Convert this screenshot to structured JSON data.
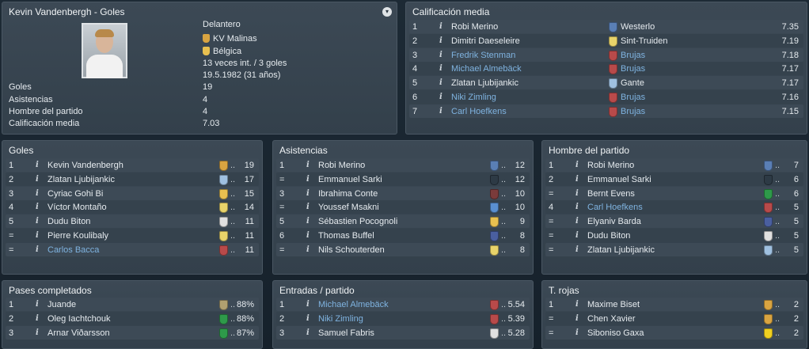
{
  "profile": {
    "title": "Kevin Vandenbergh - Goles",
    "position": "Delantero",
    "club": "KV Malinas",
    "nation": "Bélgica",
    "caps": "13 veces int. / 3 goles",
    "dob": "19.5.1982 (31 años)",
    "stats": [
      {
        "label": "Goles",
        "value": "19"
      },
      {
        "label": "Asistencias",
        "value": "4"
      },
      {
        "label": "Hombre del partido",
        "value": "4"
      },
      {
        "label": "Calificación media",
        "value": "7.03"
      }
    ]
  },
  "calificacion": {
    "title": "Calificación media",
    "rows": [
      {
        "rank": "1",
        "name": "Robi Merino",
        "club": "Westerlo",
        "value": "7.35",
        "link": false,
        "badge": "#5a7fb5"
      },
      {
        "rank": "2",
        "name": "Dimitri Daeseleire",
        "club": "Sint-Truiden",
        "value": "7.19",
        "link": false,
        "badge": "#e8d36a"
      },
      {
        "rank": "3",
        "name": "Fredrik Stenman",
        "club": "Brujas",
        "value": "7.18",
        "link": true,
        "badge": "#b84a4a"
      },
      {
        "rank": "4",
        "name": "Michael Almebäck",
        "club": "Brujas",
        "value": "7.17",
        "link": true,
        "badge": "#b84a4a"
      },
      {
        "rank": "5",
        "name": "Zlatan Ljubijankic",
        "club": "Gante",
        "value": "7.17",
        "link": false,
        "badge": "#9fc0e0"
      },
      {
        "rank": "6",
        "name": "Niki Zimling",
        "club": "Brujas",
        "value": "7.16",
        "link": true,
        "badge": "#b84a4a"
      },
      {
        "rank": "7",
        "name": "Carl Hoefkens",
        "club": "Brujas",
        "value": "7.15",
        "link": true,
        "badge": "#b84a4a"
      }
    ]
  },
  "goles": {
    "title": "Goles",
    "rows": [
      {
        "rank": "1",
        "name": "Kevin Vandenbergh",
        "value": "19",
        "link": false,
        "badge": "#d9a441"
      },
      {
        "rank": "2",
        "name": "Zlatan Ljubijankic",
        "value": "17",
        "link": false,
        "badge": "#9fc0e0"
      },
      {
        "rank": "3",
        "name": "Cyriac Gohi Bi",
        "value": "15",
        "link": false,
        "badge": "#e8c050"
      },
      {
        "rank": "4",
        "name": "Víctor Montaño",
        "value": "14",
        "link": false,
        "badge": "#e8d36a"
      },
      {
        "rank": "5",
        "name": "Dudu Biton",
        "value": "11",
        "link": false,
        "badge": "#e0e0e0"
      },
      {
        "rank": "=",
        "name": "Pierre Koulibaly",
        "value": "11",
        "link": false,
        "badge": "#e8d36a"
      },
      {
        "rank": "=",
        "name": "Carlos Bacca",
        "value": "11",
        "link": true,
        "badge": "#b84a4a"
      }
    ]
  },
  "asistencias": {
    "title": "Asistencias",
    "rows": [
      {
        "rank": "1",
        "name": "Robi Merino",
        "value": "12",
        "link": false,
        "badge": "#5a7fb5"
      },
      {
        "rank": "=",
        "name": "Emmanuel Sarki",
        "value": "12",
        "link": false,
        "badge": "#2d3a45"
      },
      {
        "rank": "3",
        "name": "Ibrahima Conte",
        "value": "10",
        "link": false,
        "badge": "#7a3b3b"
      },
      {
        "rank": "=",
        "name": "Youssef Msakni",
        "value": "10",
        "link": false,
        "badge": "#5a8fd0"
      },
      {
        "rank": "5",
        "name": "Sébastien Pocognoli",
        "value": "9",
        "link": false,
        "badge": "#e8c050"
      },
      {
        "rank": "6",
        "name": "Thomas Buffel",
        "value": "8",
        "link": false,
        "badge": "#4a5fa0"
      },
      {
        "rank": "=",
        "name": "Nils Schouterden",
        "value": "8",
        "link": false,
        "badge": "#e8d36a"
      }
    ]
  },
  "hombre": {
    "title": "Hombre del partido",
    "rows": [
      {
        "rank": "1",
        "name": "Robi Merino",
        "value": "7",
        "link": false,
        "badge": "#5a7fb5"
      },
      {
        "rank": "2",
        "name": "Emmanuel Sarki",
        "value": "6",
        "link": false,
        "badge": "#2d3a45"
      },
      {
        "rank": "=",
        "name": "Bernt Evens",
        "value": "6",
        "link": false,
        "badge": "#2e9a4a"
      },
      {
        "rank": "4",
        "name": "Carl Hoefkens",
        "value": "5",
        "link": true,
        "badge": "#b84a4a"
      },
      {
        "rank": "=",
        "name": "Elyaniv Barda",
        "value": "5",
        "link": false,
        "badge": "#4a5fa0"
      },
      {
        "rank": "=",
        "name": "Dudu Biton",
        "value": "5",
        "link": false,
        "badge": "#e0e0e0"
      },
      {
        "rank": "=",
        "name": "Zlatan Ljubijankic",
        "value": "5",
        "link": false,
        "badge": "#9fc0e0"
      }
    ]
  },
  "pases": {
    "title": "Pases completados",
    "rows": [
      {
        "rank": "1",
        "name": "Juande",
        "value": "88%",
        "link": false,
        "badge": "#b0a070"
      },
      {
        "rank": "2",
        "name": "Oleg Iachtchouk",
        "value": "88%",
        "link": false,
        "badge": "#2e9a4a"
      },
      {
        "rank": "3",
        "name": "Arnar Viðarsson",
        "value": "87%",
        "link": false,
        "badge": "#2e9a4a"
      }
    ]
  },
  "entradas": {
    "title": "Entradas / partido",
    "rows": [
      {
        "rank": "1",
        "name": "Michael Almebäck",
        "value": "5.54",
        "link": true,
        "badge": "#b84a4a"
      },
      {
        "rank": "2",
        "name": "Niki Zimling",
        "value": "5.39",
        "link": true,
        "badge": "#b84a4a"
      },
      {
        "rank": "3",
        "name": "Samuel Fabris",
        "value": "5.28",
        "link": false,
        "badge": "#e0e0e0"
      }
    ]
  },
  "rojas": {
    "title": "T. rojas",
    "rows": [
      {
        "rank": "1",
        "name": "Maxime Biset",
        "value": "2",
        "link": false,
        "badge": "#d9a441"
      },
      {
        "rank": "=",
        "name": "Chen Xavier",
        "value": "2",
        "link": false,
        "badge": "#d9a441"
      },
      {
        "rank": "=",
        "name": "Siboniso Gaxa",
        "value": "2",
        "link": false,
        "badge": "#f0d020"
      }
    ]
  },
  "common": {
    "info": "i",
    "dots": ".."
  }
}
